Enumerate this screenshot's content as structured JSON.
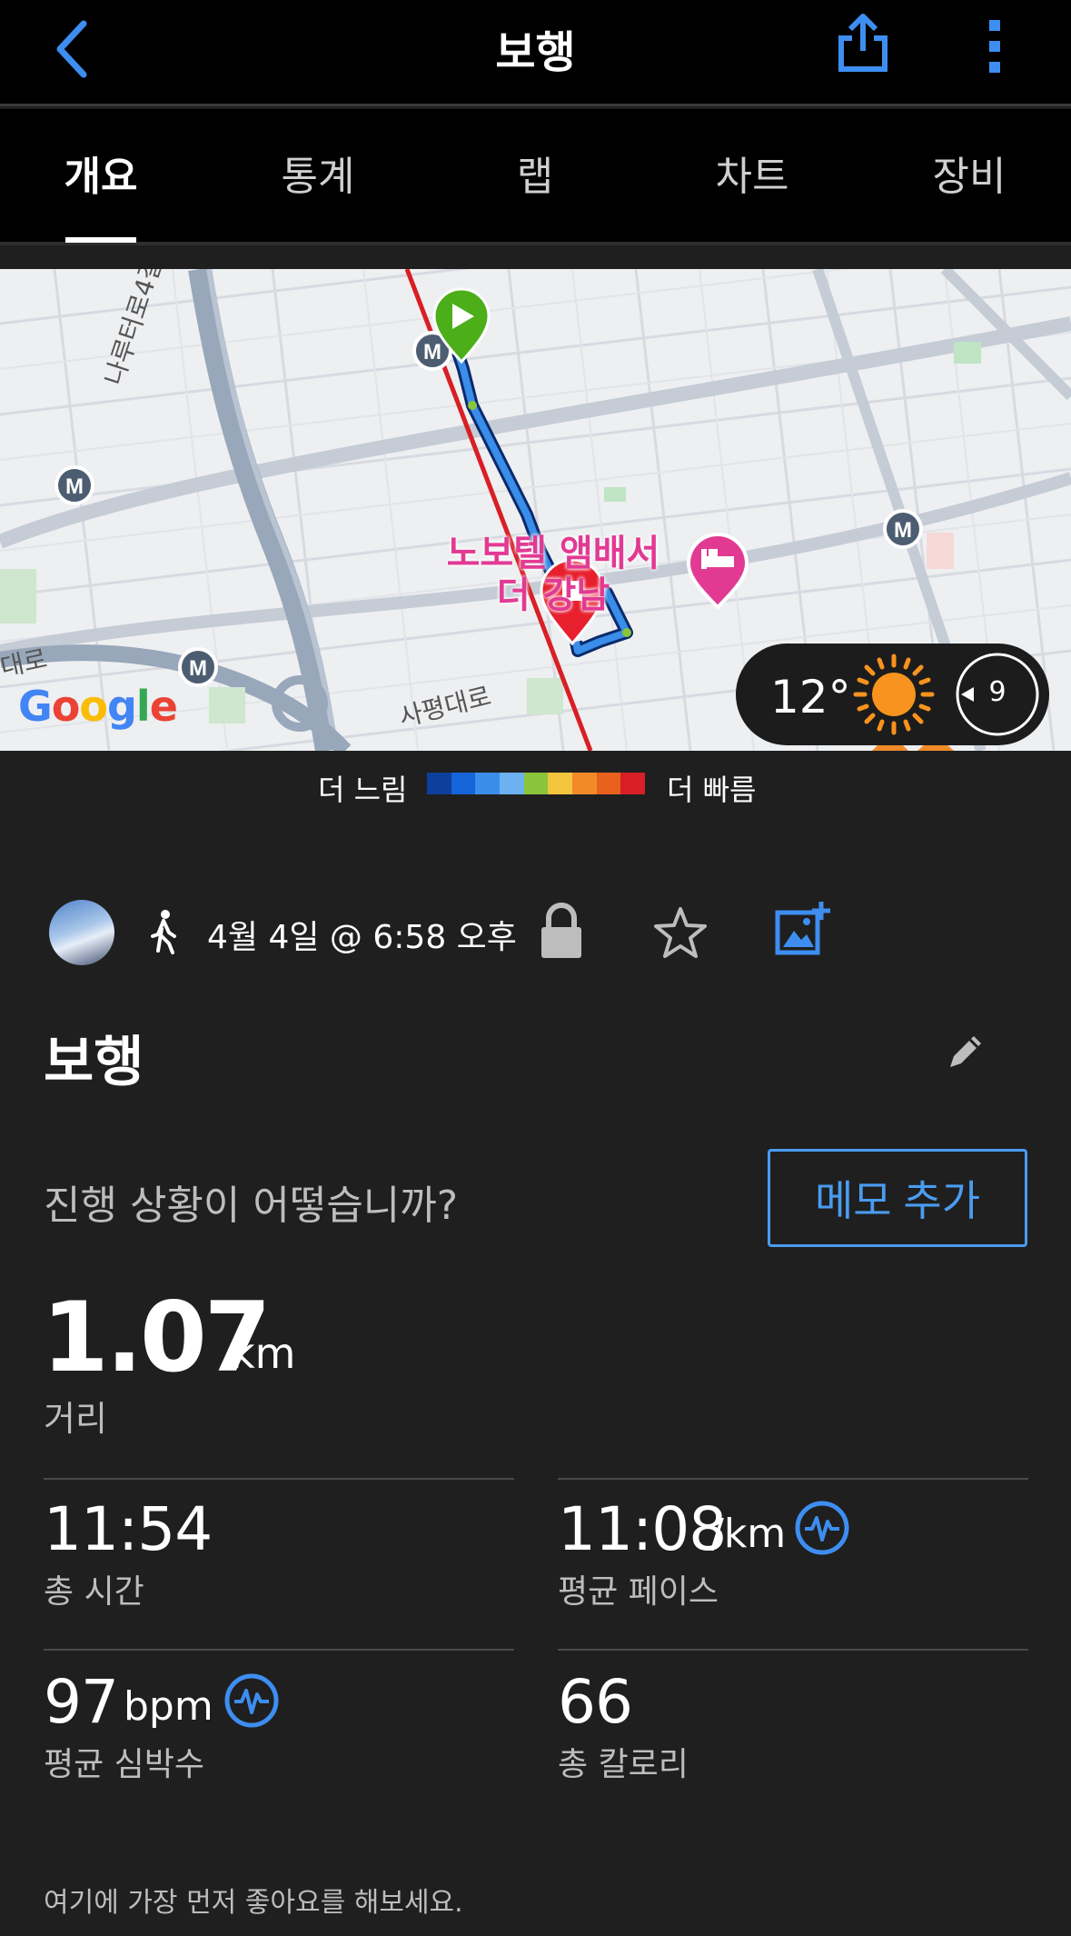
{
  "header": {
    "title": "보행",
    "back_icon": "chevron-left-icon",
    "share_icon": "share-icon",
    "more_icon": "more-vertical-icon"
  },
  "tabs": [
    {
      "label": "개요",
      "active": true
    },
    {
      "label": "통계",
      "active": false
    },
    {
      "label": "랩",
      "active": false
    },
    {
      "label": "차트",
      "active": false
    },
    {
      "label": "장비",
      "active": false
    }
  ],
  "map": {
    "street_labels": [
      "나루터로4길",
      "사평대로",
      "대로"
    ],
    "poi_name": "노보텔 앰배서더 강남",
    "attribution": "Google",
    "weather": {
      "temperature": "12°",
      "wind": "9",
      "icon": "sun-icon"
    }
  },
  "legend": {
    "slow_label": "더 느림",
    "fast_label": "더 빠름",
    "colors": [
      "#0d3f9c",
      "#1565d8",
      "#3a8de8",
      "#6cb2f0",
      "#8ac43a",
      "#f2c53d",
      "#f28a2a",
      "#e8611d",
      "#d81f26"
    ]
  },
  "activity": {
    "datetime": "4월 4일 @ 6:58 오후",
    "title": "보행",
    "prompt": "진행 상황이 어떻습니까?",
    "memo_button": "메모 추가"
  },
  "stats": {
    "distance": {
      "value": "1.07",
      "unit": "km",
      "label": "거리"
    },
    "total_time": {
      "value": "11:54",
      "label": "총 시간"
    },
    "avg_pace": {
      "value": "11:08",
      "unit": "/km",
      "label": "평균 페이스"
    },
    "avg_hr": {
      "value": "97",
      "unit": "bpm",
      "label": "평균 심박수"
    },
    "calories": {
      "value": "66",
      "label": "총 칼로리"
    }
  },
  "footer": {
    "text": "여기에 가장 먼저 좋아요를 해보세요."
  },
  "colors": {
    "accent": "#4a9cf0",
    "background": "#1f1f1f",
    "route_line": "#d81f26",
    "start_marker": "#4caf1a",
    "end_marker": "#e8202e",
    "poi": "#e23a93"
  }
}
